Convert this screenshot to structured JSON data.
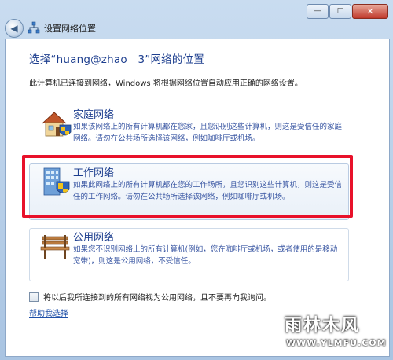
{
  "window": {
    "title": "设置网络位置",
    "min_glyph": "—",
    "max_glyph": "□",
    "close_glyph": "✕",
    "back_glyph": "◀"
  },
  "heading": "选择“huang@zhao　3”网络的位置",
  "description": "此计算机已连接到网络，Windows 将根据网络位置自动应用正确的网络设置。",
  "options": [
    {
      "title": "家庭网络",
      "desc": "如果该网络上的所有计算机都在您家，且您识别这些计算机，则这是受信任的家庭网络。请勿在公共场所选择该网络，例如咖啡厅或机场。",
      "icon": "home-network-icon"
    },
    {
      "title": "工作网络",
      "desc": "如果此网络上的所有计算机都在您的工作场所，且您识别这些计算机，则这是受信任的工作网络。请勿在公共场所选择该网络，例如咖啡厅或机场。",
      "icon": "work-network-icon"
    },
    {
      "title": "公用网络",
      "desc": "如果您不识别网络上的所有计算机(例如，您在咖啡厅或机场，或者使用的是移动宽带)，则这是公用网络，不受信任。",
      "icon": "public-network-icon"
    }
  ],
  "checkbox_label": "将以后我所连接到的所有网络视为公用网络，且不要再向我询问。",
  "help_link": "帮助我选择",
  "watermark": {
    "top": "雨林木风",
    "bottom": "WWW.YLMFU.COM"
  },
  "colors": {
    "highlight": "#e8112a",
    "heading": "#1e3f8f",
    "link": "#1e4fa8"
  }
}
